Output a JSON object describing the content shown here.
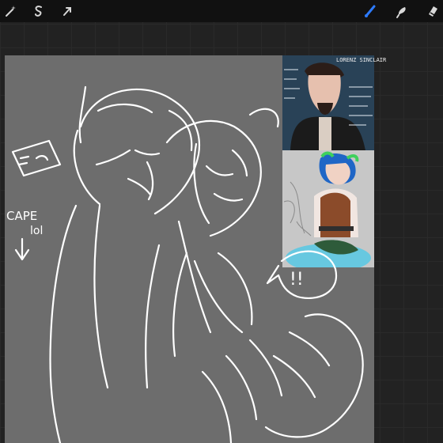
{
  "app": {
    "toolbar": {
      "left_tools": [
        {
          "name": "adjustments",
          "icon": "magic-wand-icon"
        },
        {
          "name": "selection",
          "icon": "s-selection-icon"
        },
        {
          "name": "transform",
          "icon": "arrow-icon"
        }
      ],
      "right_tools": [
        {
          "name": "brush",
          "icon": "brush-icon",
          "active": true,
          "color": "#2d7bff"
        },
        {
          "name": "smudge",
          "icon": "smudge-icon",
          "active": false
        },
        {
          "name": "eraser",
          "icon": "eraser-icon",
          "active": false
        }
      ]
    }
  },
  "canvas": {
    "background": "#6d6d6d",
    "sketch_text": {
      "cape_label": "CAPE",
      "cape_label_2": "lol",
      "exclaim": "!!"
    }
  },
  "reference": {
    "top_header": "LORENZ SINCLAIR",
    "top_notes": [
      "bags",
      "big",
      "fur",
      "mr",
      "ears"
    ]
  }
}
